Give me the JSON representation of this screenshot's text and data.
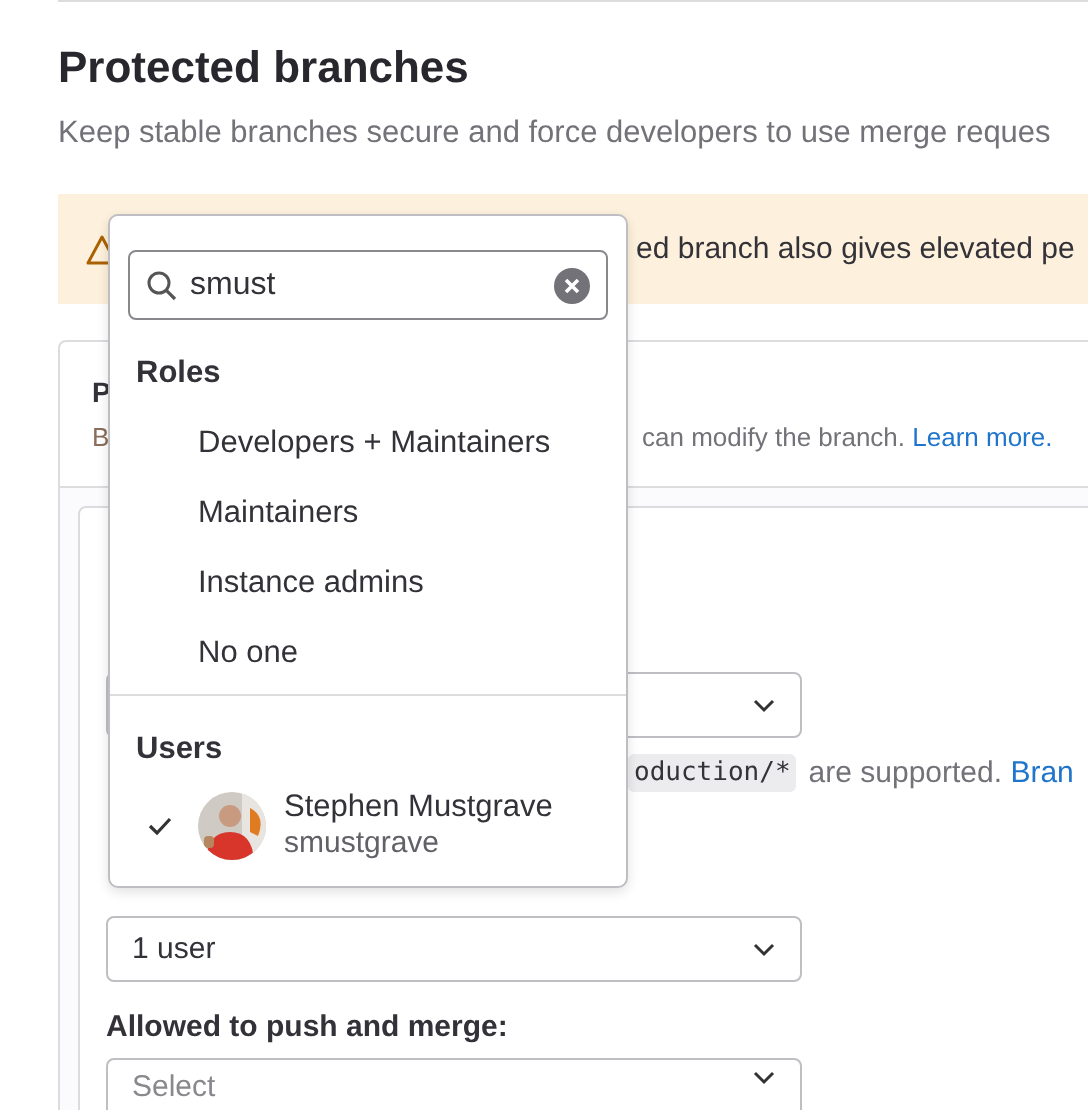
{
  "page": {
    "title": "Protected branches",
    "description": "Keep stable branches secure and force developers to use merge reques"
  },
  "alert": {
    "text": "ed branch also gives elevated pe"
  },
  "card": {
    "title": "P",
    "description_start": "B",
    "description": "can modify the branch.",
    "link": "Learn more."
  },
  "form": {
    "help": {
      "code": "oduction/*",
      "text": "are supported.",
      "link": "Bran"
    },
    "merge_select": {
      "value": "1 user"
    },
    "push_label": "Allowed to push and merge:",
    "push_select": {
      "placeholder": "Select"
    }
  },
  "dropdown": {
    "search": {
      "value": "smust"
    },
    "roles_heading": "Roles",
    "roles": [
      {
        "label": "Developers + Maintainers",
        "selected": false
      },
      {
        "label": "Maintainers",
        "selected": false
      },
      {
        "label": "Instance admins",
        "selected": false
      },
      {
        "label": "No one",
        "selected": false
      }
    ],
    "users_heading": "Users",
    "users": [
      {
        "name": "Stephen Mustgrave",
        "username": "smustgrave",
        "selected": true
      }
    ]
  }
}
